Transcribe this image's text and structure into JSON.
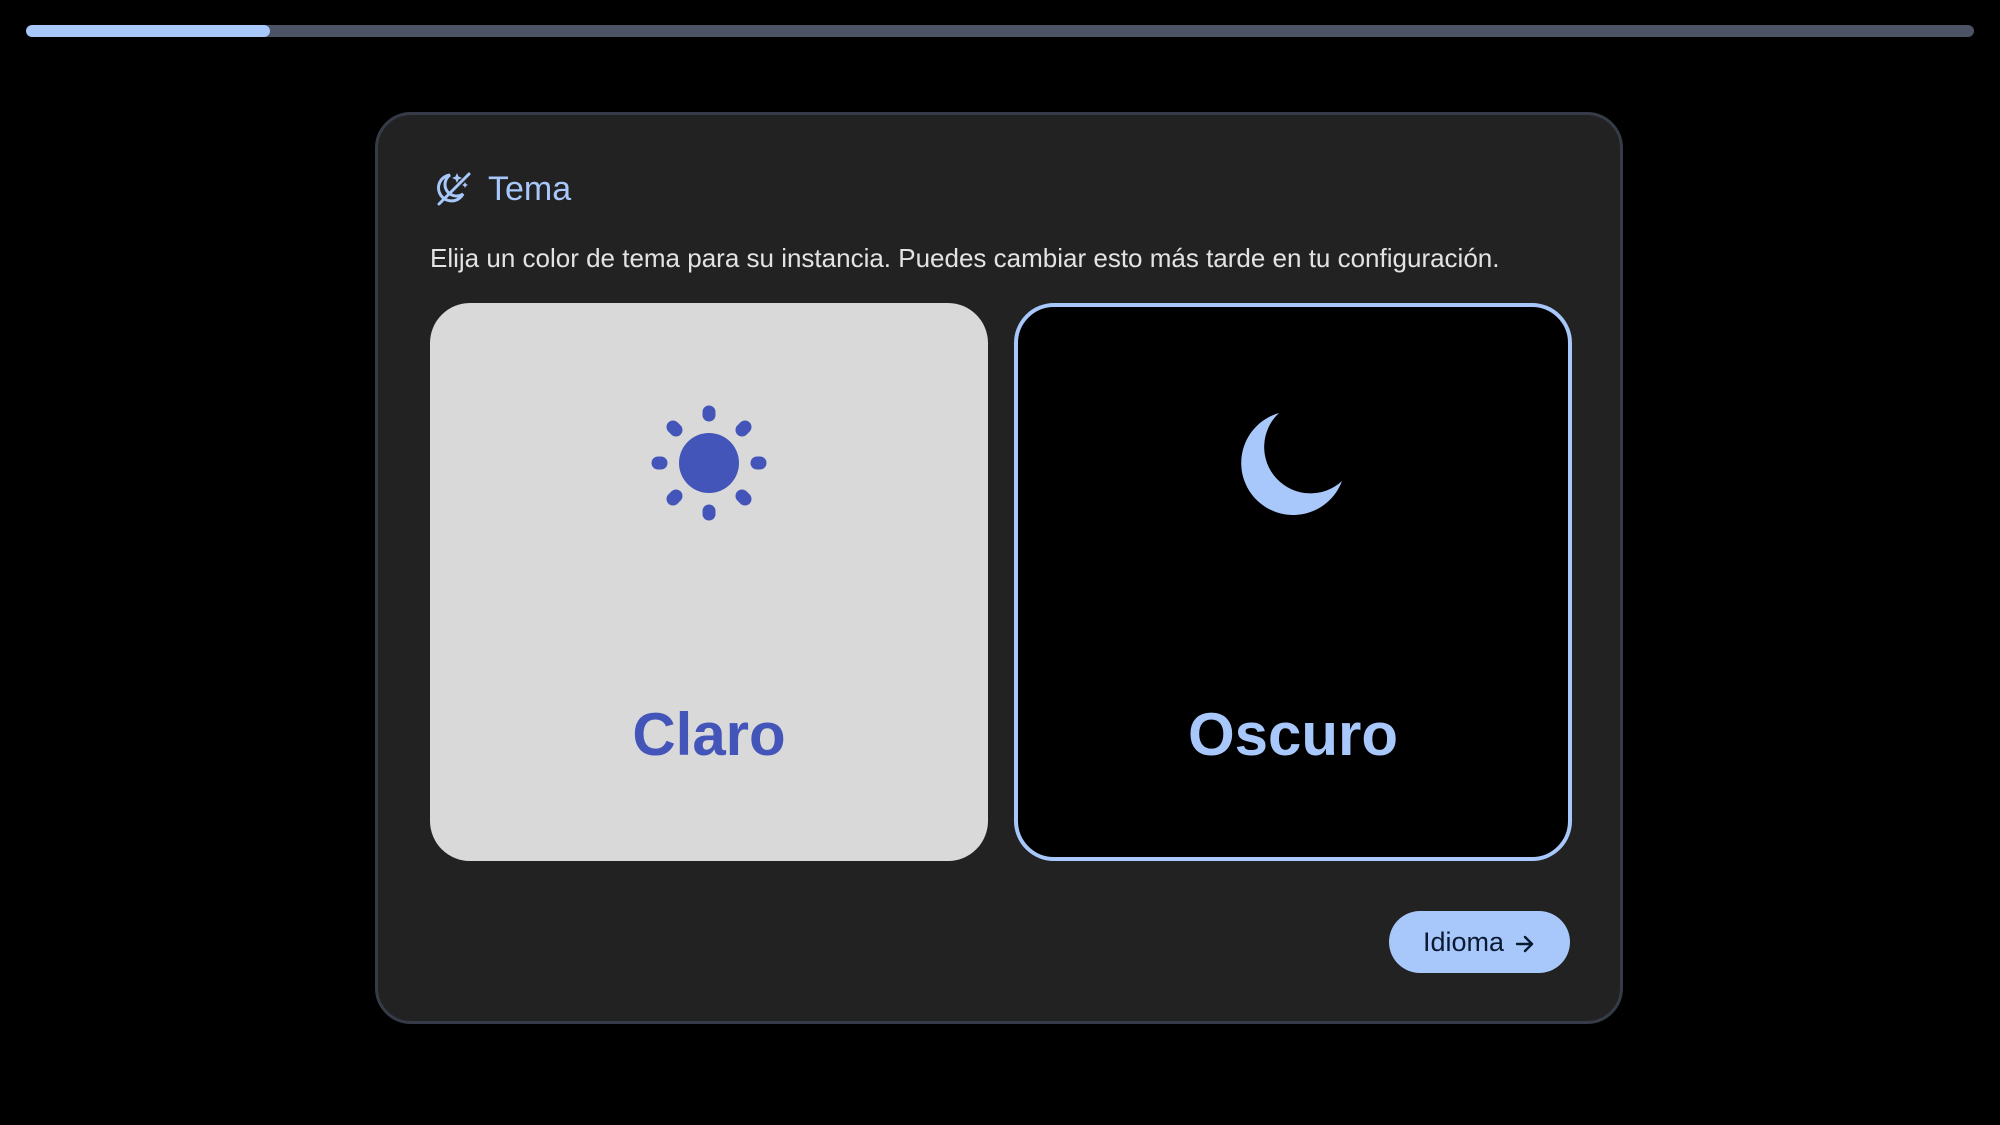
{
  "progress": {
    "value": 0.125,
    "track_color": "#4b5364",
    "fill_color": "#a8c7fa"
  },
  "card": {
    "header_icon": "theme-icon",
    "title": "Tema",
    "description": "Elija un color de tema para su instancia. Puedes cambiar esto más tarde en tu configuración."
  },
  "options": {
    "light": {
      "label": "Claro",
      "icon": "sun-icon",
      "background": "#d9d9d9",
      "accent": "#4355b9",
      "selected": false
    },
    "dark": {
      "label": "Oscuro",
      "icon": "moon-icon",
      "background": "#000000",
      "accent": "#a8c7fa",
      "selected": true
    }
  },
  "next_button": {
    "label": "Idioma",
    "icon": "arrow-right-icon",
    "color": "#a8c7fa"
  }
}
